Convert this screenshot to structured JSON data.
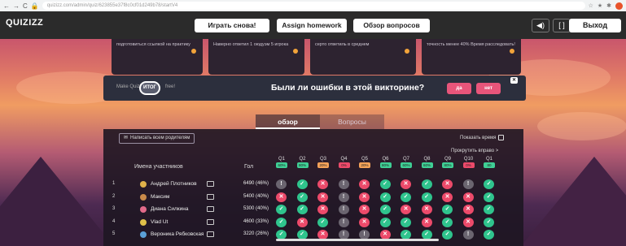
{
  "browser": {
    "url": "quizizz.com/admin/quiz/623855e37f8c0cf01d249b78/startV4",
    "back": "←",
    "forward": "→",
    "reload": "C",
    "lock": "🔒",
    "ext_icons": [
      "☆",
      "★",
      "✱"
    ]
  },
  "header": {
    "logo": "QUIZIZZ",
    "play_again": "Играть снова!",
    "assign_homework": "Assign homework",
    "review_questions": "Обзор вопросов",
    "sound_icon": "◀)",
    "fullscreen_icon": "[ ]",
    "exit": "Выход"
  },
  "stat_cards": [
    {
      "text": "подготовиться ссылкой на практику"
    },
    {
      "text": "Наверно ответил 1 оюдуэм 5 игрока"
    },
    {
      "text": "серто ответиль в среднем"
    },
    {
      "text": "точность менее 40% Время расследовать!"
    }
  ],
  "banner": {
    "make": "Make Quizizz",
    "itog": "ИТОГ",
    "free": "free!",
    "question": "Были ли ошибки в этой викторине?",
    "yes": "да",
    "no": "нет",
    "close": "✕"
  },
  "tabs": [
    {
      "label": "обзор",
      "active": true
    },
    {
      "label": "Вопросы",
      "active": false
    }
  ],
  "panel": {
    "write_parents": "Написать всем родителям",
    "show_time": "Показать время",
    "scroll_right": "Прокрутить вправо  >",
    "col_name": "Имена участников",
    "col_score": "Гол",
    "questions": [
      {
        "label": "Q1",
        "pct": "60%"
      },
      {
        "label": "Q2",
        "pct": "80%"
      },
      {
        "label": "Q3",
        "pct": "20%"
      },
      {
        "label": "Q4",
        "pct": "0%"
      },
      {
        "label": "Q5",
        "pct": "20%"
      },
      {
        "label": "Q6",
        "pct": "80%"
      },
      {
        "label": "Q7",
        "pct": "60%"
      },
      {
        "label": "Q8",
        "pct": "60%"
      },
      {
        "label": "Q9",
        "pct": "80%"
      },
      {
        "label": "Q10",
        "pct": "0%"
      },
      {
        "label": "Q1",
        "pct": "80"
      }
    ],
    "participants": [
      {
        "num": "1",
        "name": "Андрей Плотников",
        "score": "6490 (46%)",
        "avatar_color": "#e0b14a",
        "answers": [
          "skip",
          "correct",
          "wrong",
          "skip",
          "wrong",
          "correct",
          "wrong",
          "correct",
          "wrong",
          "skip",
          "correct"
        ]
      },
      {
        "num": "2",
        "name": "Максим",
        "score": "5400 (40%)",
        "avatar_color": "#c98a4a",
        "answers": [
          "wrong",
          "correct",
          "wrong",
          "skip",
          "wrong",
          "correct",
          "correct",
          "correct",
          "wrong",
          "wrong",
          "correct"
        ]
      },
      {
        "num": "3",
        "name": "Диана Силкина",
        "score": "5300 (40%)",
        "avatar_color": "#e26a8a",
        "answers": [
          "correct",
          "correct",
          "wrong",
          "skip",
          "wrong",
          "correct",
          "wrong",
          "wrong",
          "correct",
          "wrong",
          "correct"
        ]
      },
      {
        "num": "4",
        "name": "Vlad Ut",
        "score": "4600 (33%)",
        "avatar_color": "#e0c04a",
        "answers": [
          "correct",
          "wrong",
          "correct",
          "skip",
          "wrong",
          "correct",
          "correct",
          "wrong",
          "correct",
          "wrong",
          "correct"
        ]
      },
      {
        "num": "5",
        "name": "Вероника Рябковская",
        "score": "3220 (26%)",
        "avatar_color": "#5aa0d8",
        "answers": [
          "correct",
          "correct",
          "wrong",
          "skip",
          "skip",
          "wrong",
          "correct",
          "correct",
          "correct",
          "skip",
          "correct"
        ]
      }
    ],
    "answer_glyphs": {
      "correct": "✓",
      "wrong": "✕",
      "skip": "!"
    },
    "answer_colors": {
      "correct": "#2fc48d",
      "wrong": "#ec4a6a",
      "skip": "#6b6570"
    }
  }
}
